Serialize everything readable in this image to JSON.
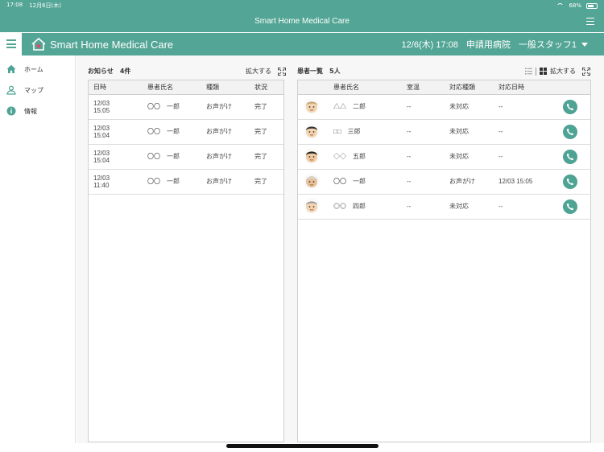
{
  "status_bar": {
    "time": "17:08",
    "date": "12月6日(木)",
    "battery": "68%"
  },
  "title_bar": {
    "title": "Smart Home Medical Care"
  },
  "header": {
    "brand": "Smart Home Medical Care",
    "datetime": "12/6(木) 17:08",
    "hospital": "申請用病院",
    "user": "一般スタッフ1"
  },
  "sidebar": {
    "items": [
      {
        "label": "ホーム",
        "icon": "home-icon"
      },
      {
        "label": "マップ",
        "icon": "map-pin-icon"
      },
      {
        "label": "情報",
        "icon": "info-icon"
      }
    ]
  },
  "notifications": {
    "title": "お知らせ",
    "count": "4件",
    "expand_label": "拡大する",
    "columns": [
      "日時",
      "患者氏名",
      "種類",
      "状況"
    ],
    "rows": [
      {
        "date": "12/03",
        "time": "15:05",
        "patient": "〇〇　一郎",
        "type": "お声がけ",
        "status": "完了"
      },
      {
        "date": "12/03",
        "time": "15:04",
        "patient": "〇〇　一郎",
        "type": "お声がけ",
        "status": "完了"
      },
      {
        "date": "12/03",
        "time": "15:04",
        "patient": "〇〇　一郎",
        "type": "お声がけ",
        "status": "完了"
      },
      {
        "date": "12/03",
        "time": "11:40",
        "patient": "〇〇　一郎",
        "type": "お声がけ",
        "status": "完了"
      }
    ]
  },
  "patients": {
    "title": "患者一覧",
    "count": "5人",
    "expand_label": "拡大する",
    "columns": [
      "",
      "患者氏名",
      "室温",
      "対応種類",
      "対応日時",
      ""
    ],
    "rows": [
      {
        "name": "△△　二郎",
        "temp": "--",
        "response_type": "未対応",
        "response_time": "--",
        "hair": "#c9a878",
        "skin": "#f3d3b0"
      },
      {
        "name": "□□　三郎",
        "temp": "--",
        "response_type": "未対応",
        "response_time": "--",
        "hair": "#333333",
        "skin": "#f3d3b0"
      },
      {
        "name": "◇◇　五郎",
        "temp": "--",
        "response_type": "未対応",
        "response_time": "--",
        "hair": "#222222",
        "skin": "#f0c9a0"
      },
      {
        "name": "〇〇　一郎",
        "temp": "--",
        "response_type": "お声がけ",
        "response_time": "12/03 15:05",
        "hair": "#d8d8d8",
        "skin": "#e8c09a"
      },
      {
        "name": "◎◎　四郎",
        "temp": "--",
        "response_type": "未対応",
        "response_time": "--",
        "hair": "#a0a0a0",
        "skin": "#f3d3b0"
      }
    ]
  },
  "colors": {
    "accent": "#53a595",
    "phone": "#4ea394"
  }
}
